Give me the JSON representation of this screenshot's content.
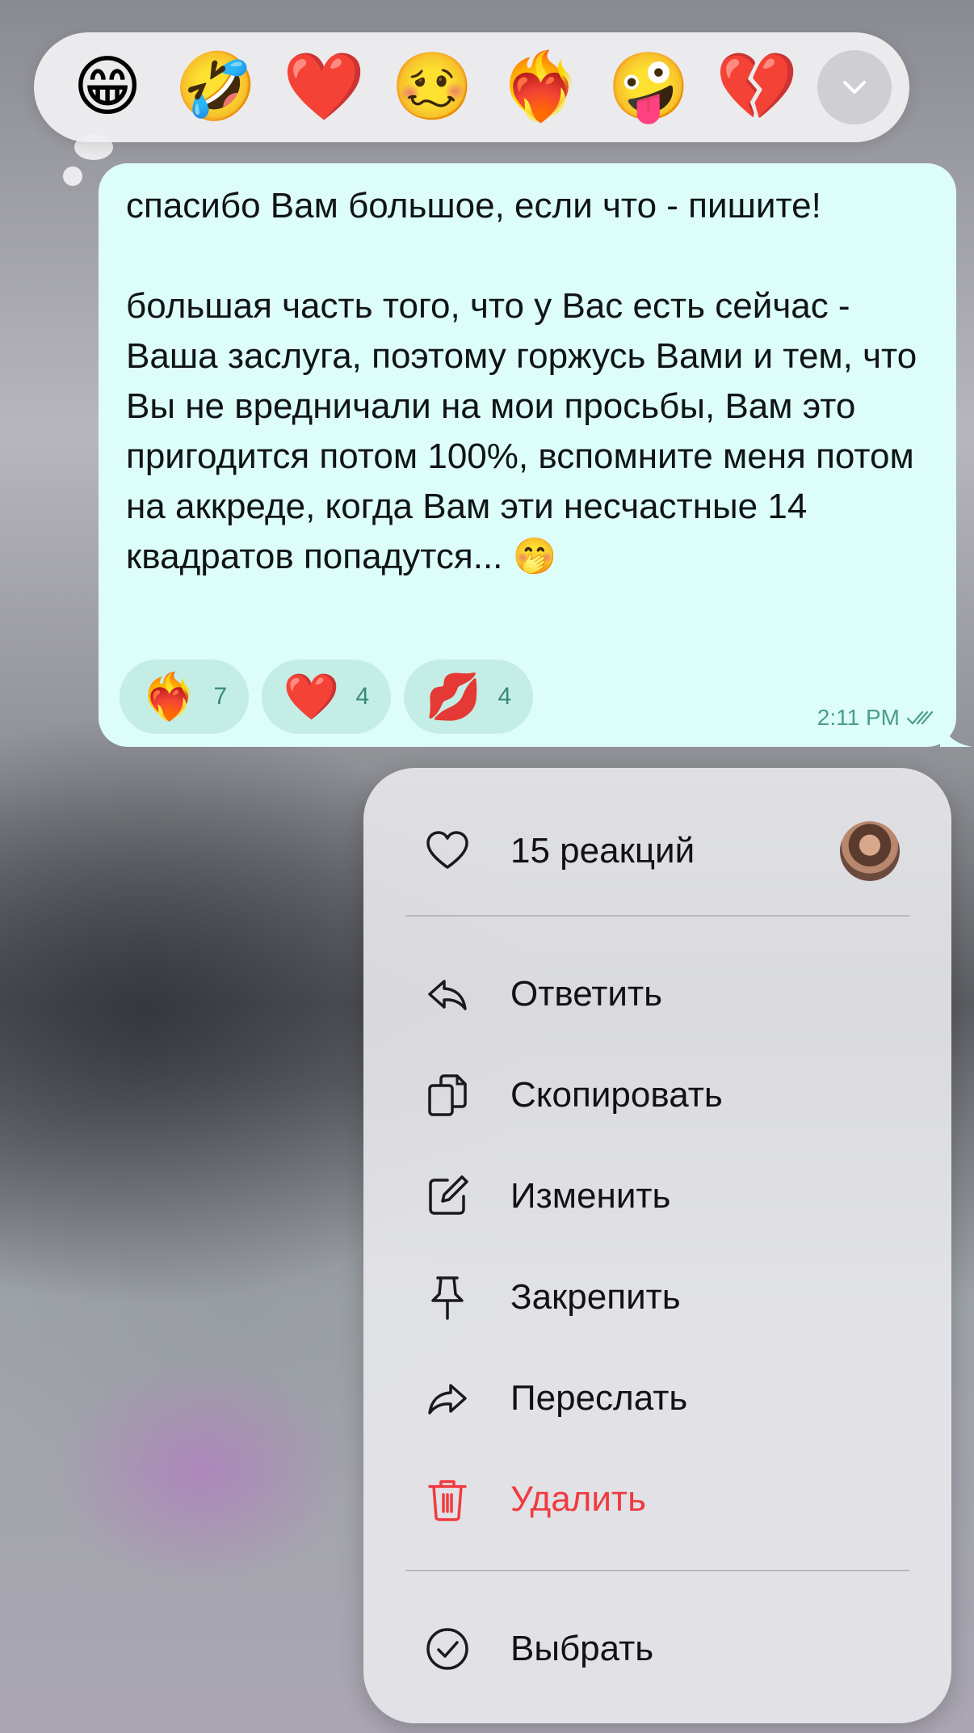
{
  "reaction_picker": {
    "emojis": [
      {
        "emoji": "😁",
        "name": "grinning-face"
      },
      {
        "emoji": "🤣",
        "name": "rolling-on-floor-laughing"
      },
      {
        "emoji": "❤️",
        "name": "red-heart"
      },
      {
        "emoji": "🥴",
        "name": "woozy-face"
      },
      {
        "emoji": "❤️‍🔥",
        "name": "heart-on-fire"
      },
      {
        "emoji": "🤪",
        "name": "zany-face"
      },
      {
        "emoji": "💔",
        "name": "broken-heart"
      }
    ],
    "more_icon": "chevron-down-icon"
  },
  "message": {
    "text": "спасибо Вам большое, если что - пишите!\n\nбольшая часть того, что у Вас есть сейчас - Ваша заслуга, поэтому горжусь Вами и тем, что Вы не вредничали на мои просьбы, Вам это пригодится потом 100%, вспомните меня потом на аккреде, когда Вам эти несчастные 14 квадратов попадутся... 🤭",
    "time": "2:11 PM",
    "read_status_icon": "double-check-icon",
    "reactions": [
      {
        "emoji": "❤️‍🔥",
        "count": "7"
      },
      {
        "emoji": "❤️",
        "count": "4"
      },
      {
        "emoji": "💋",
        "count": "4"
      }
    ]
  },
  "menu": {
    "reactions_summary": "15 реакций",
    "items": [
      {
        "label": "Ответить",
        "icon": "reply-icon"
      },
      {
        "label": "Скопировать",
        "icon": "copy-icon"
      },
      {
        "label": "Изменить",
        "icon": "edit-icon"
      },
      {
        "label": "Закрепить",
        "icon": "pin-icon"
      },
      {
        "label": "Переслать",
        "icon": "forward-icon"
      },
      {
        "label": "Удалить",
        "icon": "trash-icon",
        "color": "#ef3b3f"
      }
    ],
    "select_label": "Выбрать"
  },
  "colors": {
    "bubble": "#dcfdf8",
    "chip": "#c4eee5",
    "time": "#4c9d8a",
    "danger": "#ef3b3f"
  }
}
